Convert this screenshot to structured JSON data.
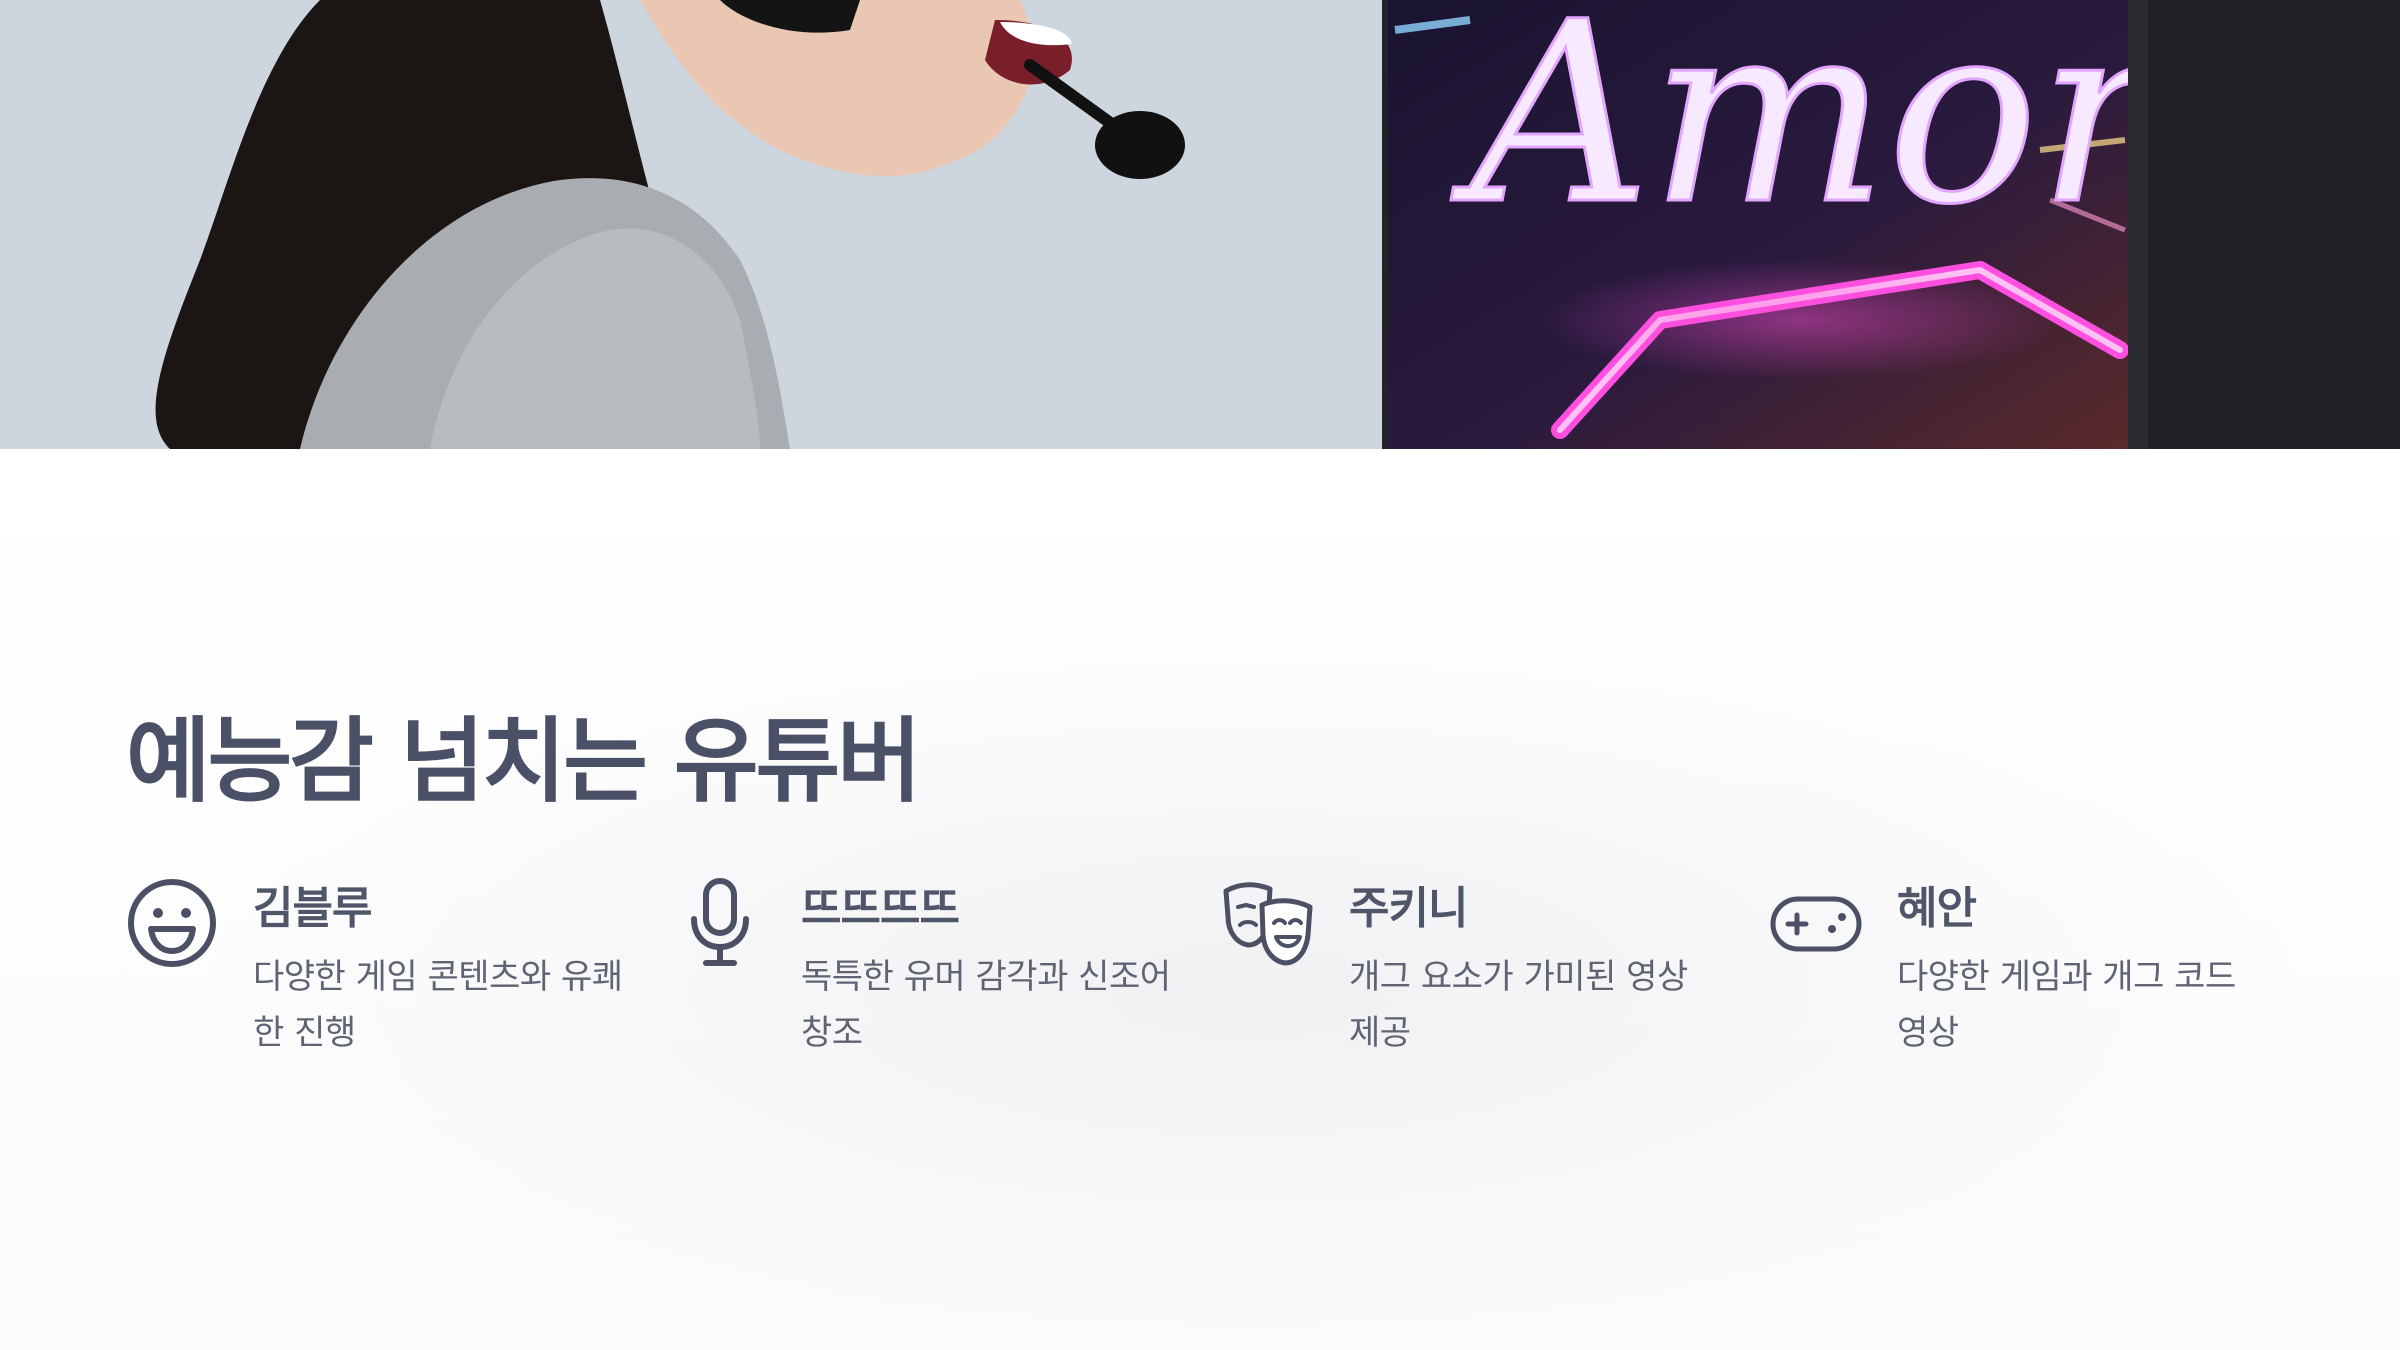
{
  "section": {
    "title": "예능감 넘치는 유튜버"
  },
  "hero": {
    "screen_text": "Amor"
  },
  "youtubers": [
    {
      "name": "김블루",
      "description": "다양한 게임 콘텐츠와 유쾌한 진행",
      "icon": "smile-icon"
    },
    {
      "name": "뜨뜨뜨뜨",
      "description": "독특한 유머 감각과 신조어 창조",
      "icon": "microphone-icon"
    },
    {
      "name": "주키니",
      "description": "개그 요소가 가미된 영상 제공",
      "icon": "theater-masks-icon"
    },
    {
      "name": "혜안",
      "description": "다양한 게임과 개그 코드 영상",
      "icon": "gamepad-icon"
    }
  ],
  "colors": {
    "heading": "#4a5065",
    "text": "#5f6474",
    "icon": "#4b5064"
  }
}
